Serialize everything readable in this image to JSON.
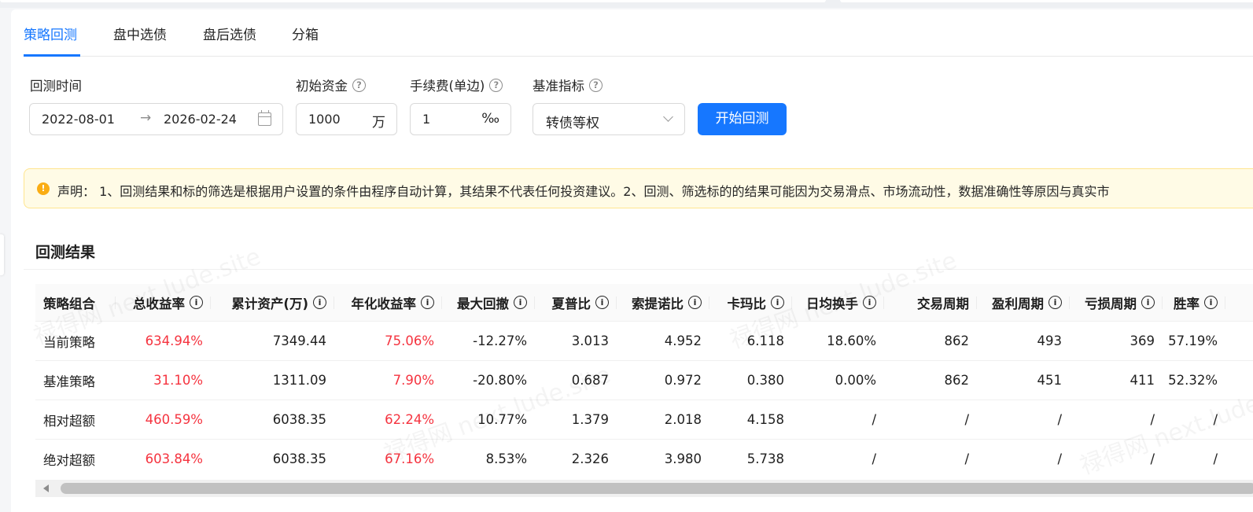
{
  "tabs": [
    {
      "label": "策略回测",
      "active": true
    },
    {
      "label": "盘中选债",
      "active": false
    },
    {
      "label": "盘后选债",
      "active": false
    },
    {
      "label": "分箱",
      "active": false
    }
  ],
  "form": {
    "period_label": "回测时间",
    "start_date": "2022-08-01",
    "end_date": "2026-02-24",
    "range_arrow": "→",
    "capital_label": "初始资金",
    "capital_value": "1000",
    "capital_unit": "万",
    "fee_label": "手续费(单边)",
    "fee_value": "1",
    "fee_unit": "‰",
    "benchmark_label": "基准指标",
    "benchmark_value": "转债等权",
    "run_button": "开始回测",
    "help_glyph": "?"
  },
  "notice": {
    "icon_glyph": "!",
    "text": "声明： 1、回测结果和标的筛选是根据用户设置的条件由程序自动计算，其结果不代表任何投资建议。2、回测、筛选标的的结果可能因为交易滑点、市场流动性，数据准确性等原因与真实市"
  },
  "results": {
    "title": "回测结果",
    "info_glyph": "i",
    "columns": [
      "策略组合",
      "总收益率",
      "累计资产(万)",
      "年化收益率",
      "最大回撤",
      "夏普比",
      "索提诺比",
      "卡玛比",
      "日均换手",
      "交易周期",
      "盈利周期",
      "亏损周期",
      "胜率"
    ],
    "rows": [
      [
        "当前策略",
        "634.94%",
        "7349.44",
        "75.06%",
        "-12.27%",
        "3.013",
        "4.952",
        "6.118",
        "18.60%",
        "862",
        "493",
        "369",
        "57.19%"
      ],
      [
        "基准策略",
        "31.10%",
        "1311.09",
        "7.90%",
        "-20.80%",
        "0.687",
        "0.972",
        "0.380",
        "0.00%",
        "862",
        "451",
        "411",
        "52.32%"
      ],
      [
        "相对超额",
        "460.59%",
        "6038.35",
        "62.24%",
        "10.77%",
        "1.379",
        "2.018",
        "4.158",
        "/",
        "/",
        "/",
        "/",
        "/"
      ],
      [
        "绝对超额",
        "603.84%",
        "6038.35",
        "67.16%",
        "8.53%",
        "2.326",
        "3.980",
        "5.738",
        "/",
        "/",
        "/",
        "/",
        "/"
      ]
    ]
  },
  "watermark": "禄得网 next.lude.site",
  "colors": {
    "accent": "#1677ff",
    "positive": "#f5333f",
    "notice_bg": "#fffbe6",
    "warning": "#faad14"
  }
}
